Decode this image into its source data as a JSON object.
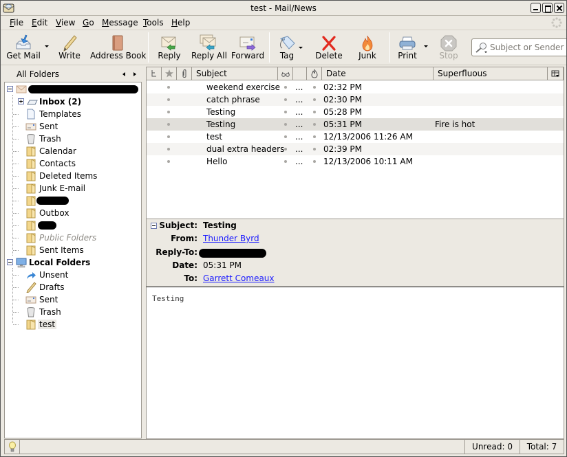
{
  "window": {
    "title": "test - Mail/News"
  },
  "menubar": {
    "items": [
      {
        "label": "File",
        "mnemonic": "F",
        "rest": "ile"
      },
      {
        "label": "Edit",
        "mnemonic": "E",
        "rest": "dit"
      },
      {
        "label": "View",
        "mnemonic": "V",
        "rest": "iew"
      },
      {
        "label": "Go",
        "mnemonic": "G",
        "rest": "o"
      },
      {
        "label": "Message",
        "mnemonic": "M",
        "rest": "essage"
      },
      {
        "label": "Tools",
        "mnemonic": "T",
        "rest": "ools"
      },
      {
        "label": "Help",
        "mnemonic": "H",
        "rest": "elp"
      }
    ]
  },
  "toolbar": {
    "get_mail": "Get Mail",
    "write": "Write",
    "address_book": "Address Book",
    "reply": "Reply",
    "reply_all": "Reply All",
    "forward": "Forward",
    "tag": "Tag",
    "delete": "Delete",
    "junk": "Junk",
    "print": "Print",
    "stop": "Stop",
    "search_placeholder": "Subject or Sender",
    "search_value": ""
  },
  "folder_pane": {
    "header": "All Folders",
    "account_name_redacted": true,
    "account_folders": [
      {
        "label": "Inbox (2)",
        "icon": "inbox-icon",
        "bold": true,
        "expandable": true
      },
      {
        "label": "Templates",
        "icon": "templates-icon"
      },
      {
        "label": "Sent",
        "icon": "sent-icon"
      },
      {
        "label": "Trash",
        "icon": "trash-icon"
      },
      {
        "label": "Calendar",
        "icon": "folder-icon"
      },
      {
        "label": "Contacts",
        "icon": "folder-icon"
      },
      {
        "label": "Deleted Items",
        "icon": "folder-icon"
      },
      {
        "label": "Junk E-mail",
        "icon": "folder-icon"
      },
      {
        "label": "",
        "icon": "folder-icon",
        "redacted": true
      },
      {
        "label": "Outbox",
        "icon": "folder-icon"
      },
      {
        "label": "",
        "icon": "folder-icon",
        "redacted": true
      },
      {
        "label": "Public Folders",
        "icon": "folder-icon",
        "italic": true
      },
      {
        "label": "Sent Items",
        "icon": "folder-icon"
      }
    ],
    "local_folders": {
      "label": "Local Folders",
      "children": [
        {
          "label": "Unsent",
          "icon": "unsent-icon"
        },
        {
          "label": "Drafts",
          "icon": "drafts-icon"
        },
        {
          "label": "Sent",
          "icon": "sent-icon"
        },
        {
          "label": "Trash",
          "icon": "trash-icon"
        },
        {
          "label": "test",
          "icon": "folder-icon",
          "selected": true
        }
      ]
    }
  },
  "thread_pane": {
    "columns": {
      "thread": "",
      "star": "",
      "attachment": "",
      "subject": "Subject",
      "read": "",
      "sender": "",
      "junk": "",
      "date": "Date",
      "superfluous": "Superfluous"
    },
    "rows": [
      {
        "subject": "weekend exercise",
        "sender": "...",
        "date": "02:32 PM",
        "superfluous": ""
      },
      {
        "subject": "catch phrase",
        "sender": "...",
        "date": "02:30 PM",
        "superfluous": ""
      },
      {
        "subject": "Testing",
        "sender": "...",
        "date": "05:28 PM",
        "superfluous": ""
      },
      {
        "subject": "Testing",
        "sender": "...",
        "date": "05:31 PM",
        "superfluous": "Fire is hot",
        "selected": true
      },
      {
        "subject": "test",
        "sender": "...",
        "date": "12/13/2006 11:26 AM",
        "superfluous": ""
      },
      {
        "subject": "dual extra headers",
        "sender": "...",
        "date": "02:39 PM",
        "superfluous": ""
      },
      {
        "subject": "Hello",
        "sender": "...",
        "date": "12/13/2006 10:11 AM",
        "superfluous": ""
      }
    ]
  },
  "message_header": {
    "subject_label": "Subject:",
    "subject": "Testing",
    "from_label": "From:",
    "from": "Thunder Byrd",
    "reply_to_label": "Reply-To:",
    "reply_to_redacted": true,
    "date_label": "Date:",
    "date": "05:31 PM",
    "to_label": "To:",
    "to": "Garrett Comeaux"
  },
  "message_body": {
    "text": "Testing"
  },
  "status_bar": {
    "message": "",
    "unread": "Unread: 0",
    "total": "Total: 7"
  },
  "colors": {
    "chrome_bg": "#ece9e2",
    "link": "#1a1aff",
    "selected_row": "#e1dfda"
  }
}
